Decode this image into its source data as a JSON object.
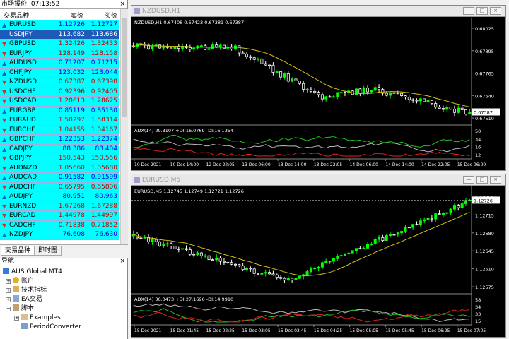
{
  "market_watch": {
    "title": "市场报价: 07:13:52",
    "close": "×",
    "col_symbol": "交易品种",
    "col_bid": "卖价",
    "col_ask": "买价",
    "selected_index": 1,
    "rows": [
      {
        "symbol": "EURUSD",
        "bid": "1.12726",
        "ask": "1.12727",
        "dir": "up"
      },
      {
        "symbol": "USDJPY",
        "bid": "113.682",
        "ask": "113.686",
        "dir": "up"
      },
      {
        "symbol": "GBPUSD",
        "bid": "1.32426",
        "ask": "1.32433",
        "dir": "dn"
      },
      {
        "symbol": "EURJPY",
        "bid": "128.149",
        "ask": "128.158",
        "dir": "dn"
      },
      {
        "symbol": "AUDUSD",
        "bid": "0.71207",
        "ask": "0.71215",
        "dir": "up"
      },
      {
        "symbol": "CHFJPY",
        "bid": "123.032",
        "ask": "123.044",
        "dir": "up"
      },
      {
        "symbol": "NZDUSD",
        "bid": "0.67387",
        "ask": "0.67398",
        "dir": "dn"
      },
      {
        "symbol": "USDCHF",
        "bid": "0.92396",
        "ask": "0.92405",
        "dir": "dn"
      },
      {
        "symbol": "USDCAD",
        "bid": "1.28613",
        "ask": "1.28625",
        "dir": "dn"
      },
      {
        "symbol": "EURGBP",
        "bid": "0.85119",
        "ask": "0.85130",
        "dir": "up"
      },
      {
        "symbol": "EURAUD",
        "bid": "1.58297",
        "ask": "1.58314",
        "dir": "dn"
      },
      {
        "symbol": "EURCHF",
        "bid": "1.04155",
        "ask": "1.04167",
        "dir": "dn"
      },
      {
        "symbol": "GBPCHF",
        "bid": "1.22353",
        "ask": "1.22374",
        "dir": "up"
      },
      {
        "symbol": "CADJPY",
        "bid": "88.386",
        "ask": "88.404",
        "dir": "up"
      },
      {
        "symbol": "GBPJPY",
        "bid": "150.543",
        "ask": "150.556",
        "dir": "dn"
      },
      {
        "symbol": "AUDNZD",
        "bid": "1.05660",
        "ask": "1.05680",
        "dir": "dn"
      },
      {
        "symbol": "AUDCAD",
        "bid": "0.91582",
        "ask": "0.91599",
        "dir": "up"
      },
      {
        "symbol": "AUDCHF",
        "bid": "0.65795",
        "ask": "0.65806",
        "dir": "dn"
      },
      {
        "symbol": "AUDJPY",
        "bid": "80.951",
        "ask": "80.963",
        "dir": "up"
      },
      {
        "symbol": "EURNZD",
        "bid": "1.67268",
        "ask": "1.67288",
        "dir": "dn"
      },
      {
        "symbol": "EURCAD",
        "bid": "1.44978",
        "ask": "1.44997",
        "dir": "dn"
      },
      {
        "symbol": "CADCHF",
        "bid": "0.71838",
        "ask": "0.71852",
        "dir": "dn"
      },
      {
        "symbol": "NZDJPY",
        "bid": "76.608",
        "ask": "76.630",
        "dir": "up"
      }
    ],
    "tabs": [
      "交易品种",
      "即时图"
    ]
  },
  "navigator": {
    "title": "导航",
    "close": "×",
    "items": [
      "AUS Global MT4",
      "账户",
      "技术指标",
      "EA交易",
      "脚本",
      "Examples",
      "PeriodConverter"
    ]
  },
  "chart1": {
    "title": "NZDUSD,H1",
    "info": "NZDUSD,H1  0.67408 0.67423 0.67381 0.67387",
    "price_labels": [
      "0.68025",
      "0.67895",
      "0.67765",
      "0.67640",
      "0.67510"
    ],
    "current": "0.67387",
    "indicator_info": "ADX(14) 29.3107 +DI:16.0769 -DI:16.1354",
    "ind_levels": [
      "50",
      "34",
      "16",
      "12"
    ],
    "time_labels": [
      "10 Dec 2021",
      "10 Dec 14:00",
      "12 Dec 22:05",
      "13 Dec 06:00",
      "13 Dec 14:00",
      "13 Dec 22:05",
      "14 Dec 06:00",
      "14 Dec 14:00",
      "14 Dec 22:05",
      "15 Dec 06:00"
    ],
    "colors": {
      "bull": "#00ff00",
      "bear": "#ffffff",
      "ma": "#d4c010",
      "adx": "#b8b8b8",
      "plus_di": "#20c020",
      "minus_di": "#e02020"
    }
  },
  "chart2": {
    "title": "EURUSD,M5",
    "info": "EURUSD,M5  1.12745 1.12749 1.12721 1.12726",
    "price_labels": [
      "1.12750",
      "1.12715",
      "1.12680",
      "1.12645",
      "1.12610",
      "1.12575"
    ],
    "current": "1.12726",
    "indicator_info": "ADX(14) 36.3473 +DI:27.1696 -DI:14.9910",
    "ind_levels": [
      "58",
      "34",
      "33",
      "15"
    ],
    "time_labels": [
      "15 Dec 2021",
      "15 Dec 01:45",
      "15 Dec 02:25",
      "15 Dec 03:05",
      "15 Dec 03:45",
      "15 Dec 04:25",
      "15 Dec 05:05",
      "15 Dec 05:45",
      "15 Dec 06:25",
      "15 Dec 07:05"
    ],
    "colors": {
      "bull": "#00ff00",
      "bear": "#ffffff",
      "ma": "#d4c010",
      "adx": "#b8b8b8",
      "plus_di": "#20c020",
      "minus_di": "#e02020"
    }
  },
  "window_buttons": [
    "—",
    "□",
    "×"
  ]
}
